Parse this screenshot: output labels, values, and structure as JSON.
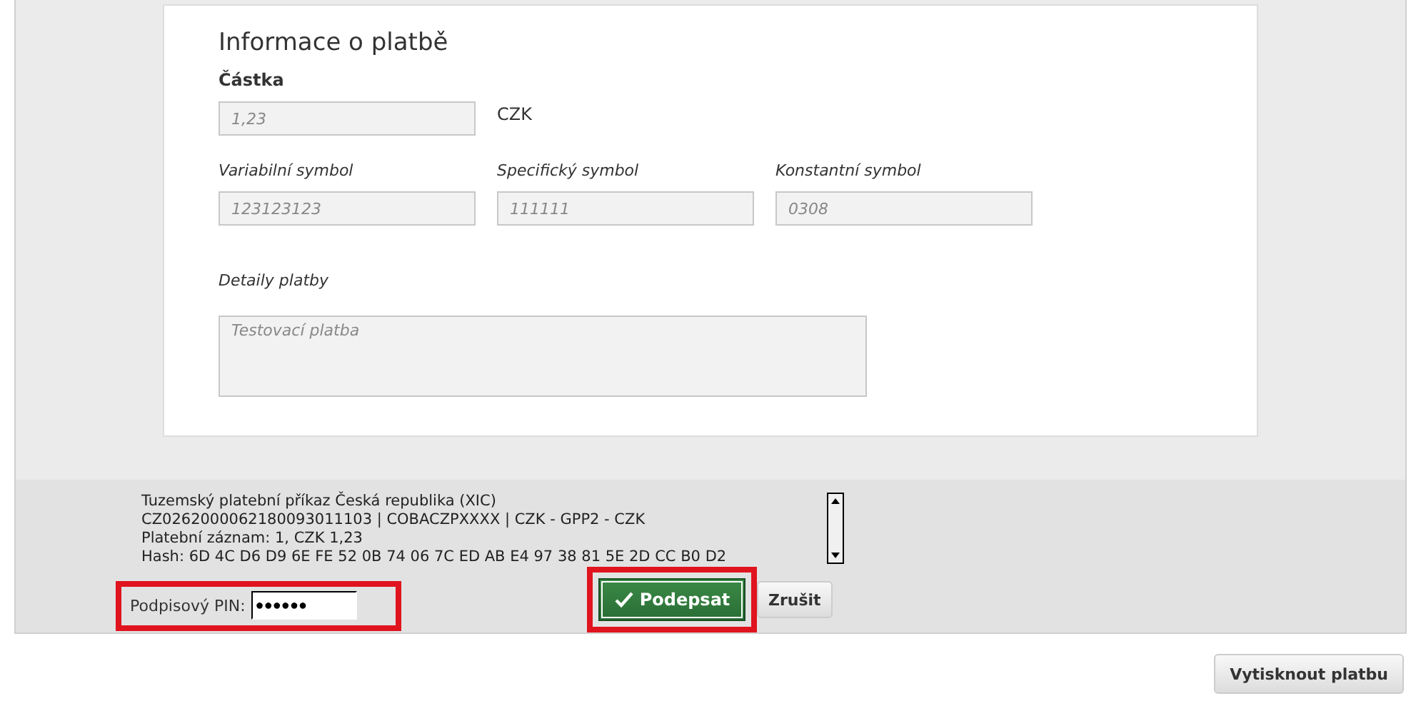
{
  "payment_info": {
    "title": "Informace o platbě",
    "amount": {
      "label": "Částka",
      "value": "1,23",
      "currency": "CZK"
    },
    "symbols": [
      {
        "label": "Variabilní symbol",
        "value": "123123123"
      },
      {
        "label": "Specifický symbol",
        "value": "111111"
      },
      {
        "label": "Konstantní symbol",
        "value": "0308"
      }
    ],
    "details": {
      "label": "Detaily platby",
      "value": "Testovací platba"
    }
  },
  "signing": {
    "summary_lines": [
      "Tuzemský platební příkaz Česká republika (XIC)",
      "CZ0262000062180093011103 | COBACZPXXXX | CZK - GPP2 - CZK",
      "Platební záznam: 1, CZK 1,23",
      "Hash: 6D 4C D6 D9 6E FE 52 0B 74 06 7C ED AB E4 97 38 81 5E 2D CC B0 D2"
    ],
    "pin": {
      "label": "Podpisový PIN:",
      "value": "●●●●●●"
    },
    "sign_button": "Podepsat",
    "cancel_button": "Zrušit"
  },
  "print_button": "Vytisknout platbu"
}
